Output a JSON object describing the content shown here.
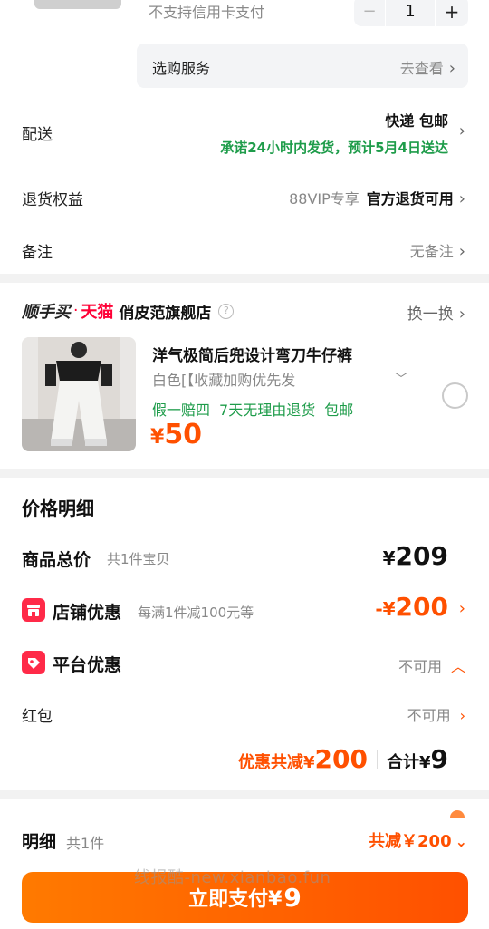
{
  "top": {
    "no_credit": "不支持信用卡支付",
    "stepper": {
      "minus": "−",
      "qty": "1",
      "plus": "+"
    },
    "service": {
      "label": "选购服务",
      "action": "去查看"
    }
  },
  "shipping": {
    "label": "配送",
    "mode": "快递 包邮",
    "promise": "承诺24小时内发货，预计5月4日送达"
  },
  "returns": {
    "label": "退货权益",
    "vip": "88VIP专享",
    "value": "官方退货可用"
  },
  "note": {
    "label": "备注",
    "value": "无备注"
  },
  "store": {
    "brand_a": "顺手买",
    "brand_dot": "·",
    "brand_b": "天猫",
    "name": "俏皮范旗舰店",
    "help": "?",
    "swap": "换一换",
    "product": {
      "title": "洋气极简后兜设计弯刀牛仔裤",
      "spec": "白色[【收藏加购优先发",
      "tags": [
        "假一赔四",
        "7天无理由退货",
        "包邮"
      ],
      "currency": "¥",
      "price": "50"
    }
  },
  "price_detail": {
    "heading": "价格明细",
    "total_label": "商品总价",
    "total_sub": "共1件宝贝",
    "total_currency": "¥",
    "total_value": "209",
    "shop_label": "店铺优惠",
    "shop_sub": "每满1件减100元等",
    "shop_prefix": "-¥",
    "shop_value": "200",
    "platform_label": "平台优惠",
    "platform_value": "不可用",
    "red_label": "红包",
    "red_value": "不可用",
    "discount_prefix": "优惠共减¥",
    "discount_value": "200",
    "sum_prefix": "合计¥",
    "sum_value": "9"
  },
  "bottom": {
    "detail_label": "明细",
    "detail_sub": "共1件",
    "detail_right": "共减￥200",
    "watermark": "线报酷-new.xianbao.fun",
    "pay_label": "立即支付¥",
    "pay_value": "9"
  },
  "colors": {
    "accent": "#ff5000",
    "green": "#1e9c4a",
    "tmall_red": "#ff0036"
  }
}
